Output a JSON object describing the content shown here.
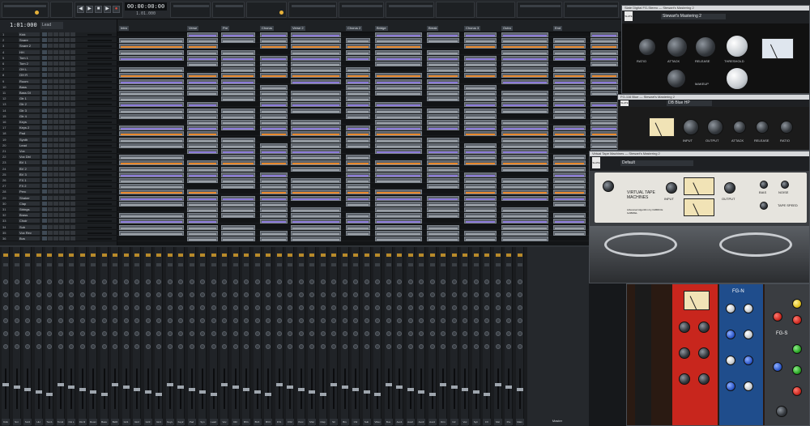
{
  "transport": {
    "time": "00:00:00:00",
    "sub_time": "1.01.000",
    "play_icon": "play-icon",
    "stop_icon": "stop-icon",
    "record_icon": "record-icon",
    "rewind_icon": "rewind-icon",
    "forward_icon": "forward-icon"
  },
  "track_view": {
    "clock": "1:01:000",
    "filter_label": "Lead",
    "tracks": [
      {
        "num": "1",
        "name": "Kick"
      },
      {
        "num": "2",
        "name": "Snare"
      },
      {
        "num": "3",
        "name": "Snare 2"
      },
      {
        "num": "4",
        "name": "HH"
      },
      {
        "num": "5",
        "name": "Tom 1"
      },
      {
        "num": "6",
        "name": "Tom 2"
      },
      {
        "num": "7",
        "name": "OH L"
      },
      {
        "num": "8",
        "name": "OH R"
      },
      {
        "num": "9",
        "name": "Room"
      },
      {
        "num": "10",
        "name": "Bass"
      },
      {
        "num": "11",
        "name": "Bass DI"
      },
      {
        "num": "12",
        "name": "Gtr 1"
      },
      {
        "num": "13",
        "name": "Gtr 2"
      },
      {
        "num": "14",
        "name": "Gtr 3"
      },
      {
        "num": "15",
        "name": "Gtr 4"
      },
      {
        "num": "16",
        "name": "Keys"
      },
      {
        "num": "17",
        "name": "Keys 2"
      },
      {
        "num": "18",
        "name": "Pad"
      },
      {
        "num": "19",
        "name": "Synth"
      },
      {
        "num": "20",
        "name": "Lead"
      },
      {
        "num": "21",
        "name": "Vox"
      },
      {
        "num": "22",
        "name": "Vox Dbl"
      },
      {
        "num": "23",
        "name": "BV 1"
      },
      {
        "num": "24",
        "name": "BV 2"
      },
      {
        "num": "25",
        "name": "BV 3"
      },
      {
        "num": "26",
        "name": "FX 1"
      },
      {
        "num": "27",
        "name": "FX 2"
      },
      {
        "num": "28",
        "name": "Perc"
      },
      {
        "num": "29",
        "name": "Shaker"
      },
      {
        "num": "30",
        "name": "Clap"
      },
      {
        "num": "31",
        "name": "Strings"
      },
      {
        "num": "32",
        "name": "Brass"
      },
      {
        "num": "33",
        "name": "Choir"
      },
      {
        "num": "34",
        "name": "Sub"
      },
      {
        "num": "35",
        "name": "Vox Rev"
      },
      {
        "num": "36",
        "name": "Bus"
      }
    ],
    "markers": [
      "Intro",
      "Verse",
      "Pre",
      "Chorus",
      "Verse 2",
      "Chorus 2",
      "Bridge",
      "Break",
      "Chorus 3",
      "Outro",
      "End"
    ]
  },
  "console": {
    "channel_names": [
      "Kick",
      "Snr",
      "Snr2",
      "HH",
      "Tom1",
      "Tom2",
      "OH L",
      "OH R",
      "Room",
      "Bass",
      "BsDI",
      "Gtr1",
      "Gtr2",
      "Gtr3",
      "Gtr4",
      "Keys",
      "Key2",
      "Pad",
      "Syn",
      "Lead",
      "Vox",
      "Dbl",
      "BV1",
      "BV2",
      "BV3",
      "FX1",
      "FX2",
      "Perc",
      "Shkr",
      "Clap",
      "Str",
      "Brs",
      "Chr",
      "Sub",
      "VRev",
      "Bus",
      "Aux1",
      "Aux2",
      "Aux3",
      "Aux4",
      "Drm",
      "Gtr",
      "Voc",
      "Syn",
      "FX",
      "Mst",
      "Pre",
      "Main"
    ],
    "bus_label": "Master"
  },
  "plugins": {
    "mastering": {
      "title": "Slate Digital FG-Stereo — Stewart's Mastering 2",
      "preset": "Stewart's Mastering 2",
      "logo": "SLATE DIGITAL",
      "labels": [
        "RATIO",
        "ATTACK",
        "RELEASE",
        "THRESHOLD",
        "MAKEUP"
      ]
    },
    "fg116": {
      "title": "FG-116 Blue — Stewart's Mastering 2",
      "preset": "DB Blue HP",
      "logo": "SLATE",
      "labels": [
        "INPUT",
        "OUTPUT",
        "ATTACK",
        "RELEASE",
        "RATIO"
      ]
    },
    "tape": {
      "title": "Virtual Tape Machines — Stewart's Mastering 2",
      "preset": "Default",
      "logo": "SLATE",
      "machine_name": "VIRTUAL TAPE MACHINES",
      "credits": "Advanced Algorithm by FABRICE GABRIEL",
      "labels": [
        "INPUT",
        "OUTPUT",
        "BIAS",
        "NOISE",
        "TAPE SPEED"
      ]
    },
    "eq": {
      "title": "FG-N / FG-S EQ",
      "fgn_label": "FG-N",
      "fgs_label": "FG-S"
    }
  },
  "colors": {
    "accent": "#e6b13a",
    "record": "#e24a3b",
    "clip_gray": "#5a6068",
    "waveform_purple": "#8c7ad9",
    "waveform_orange": "#e8882c",
    "plugin_red": "#c8261d",
    "plugin_blue": "#2a55c8"
  }
}
